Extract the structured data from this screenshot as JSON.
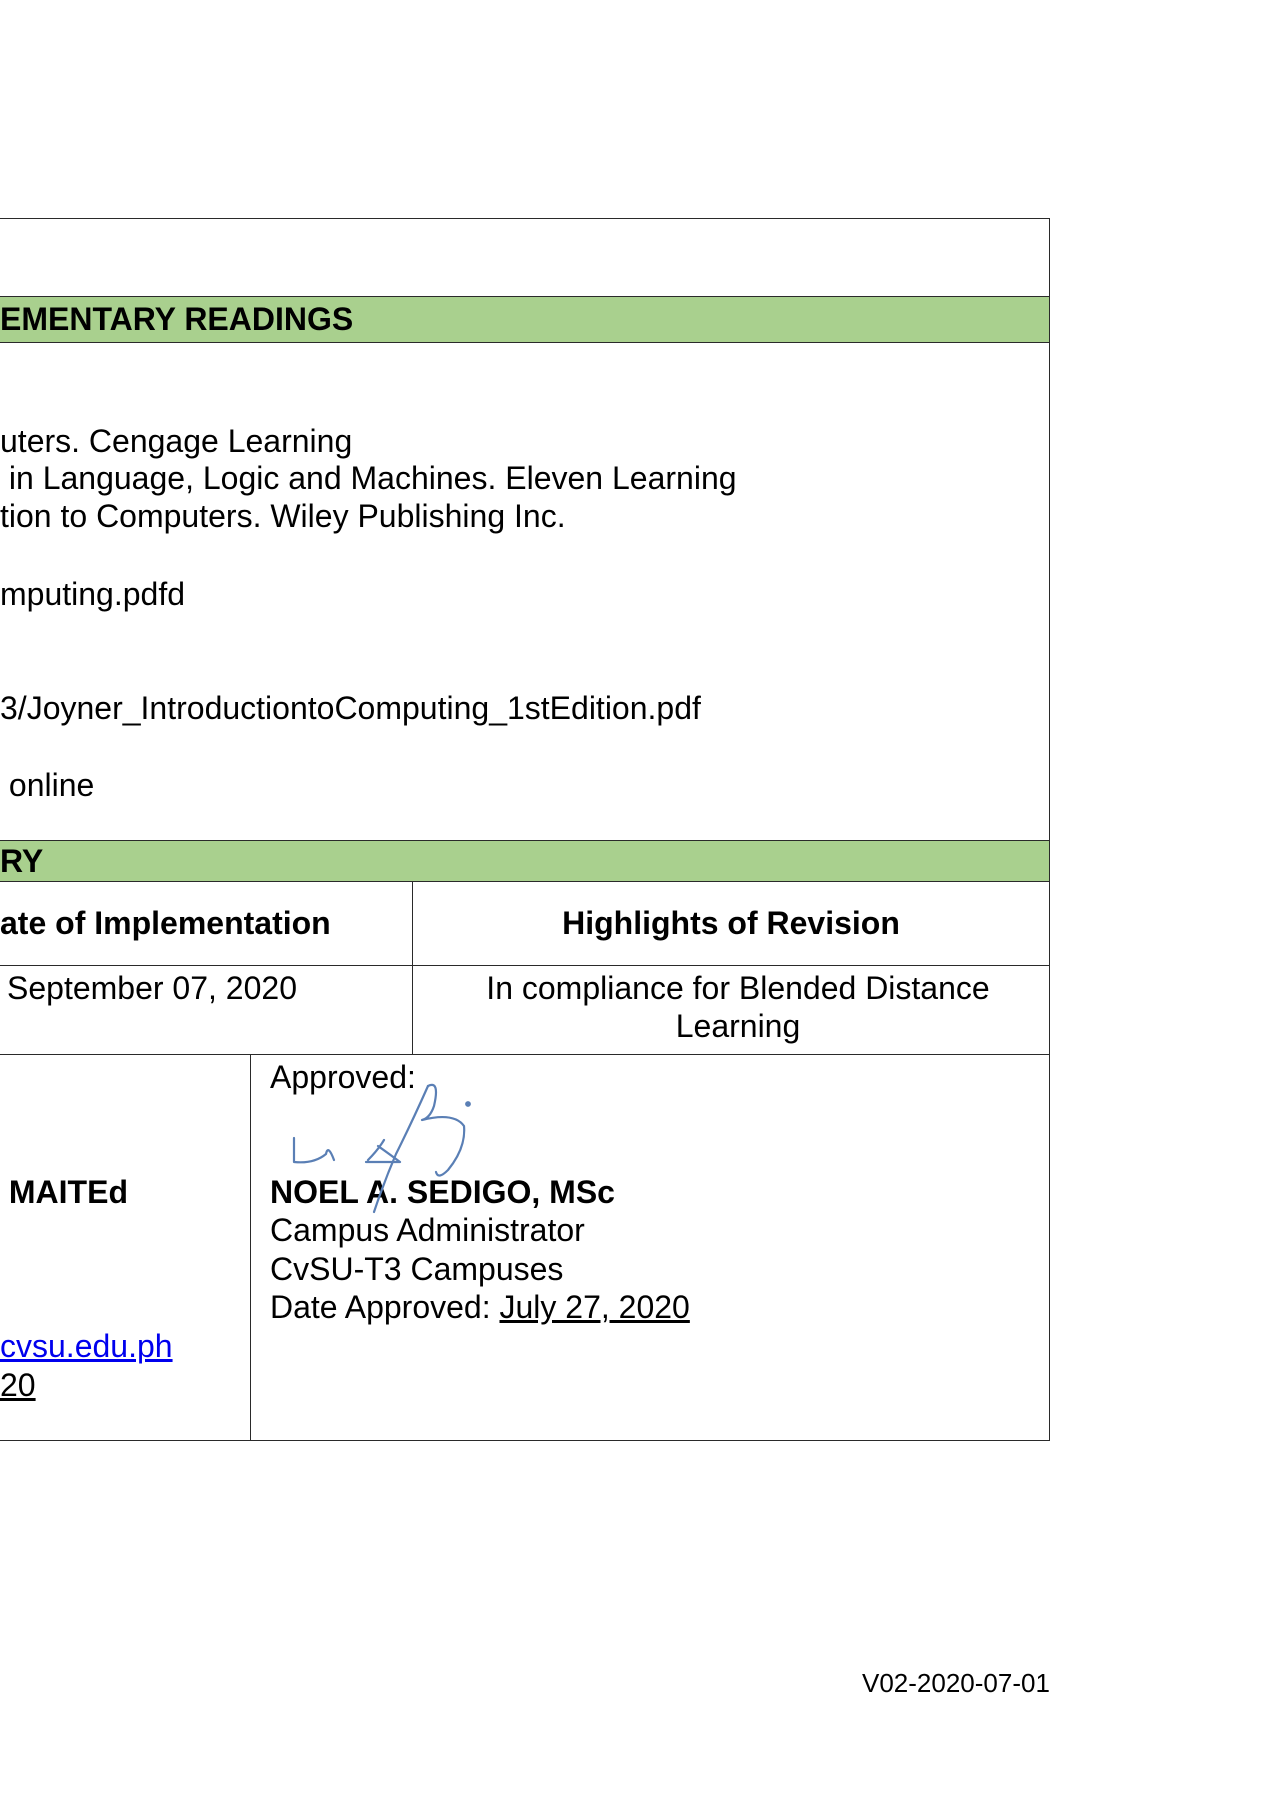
{
  "references": {
    "header": "EMENTARY READINGS",
    "lines": [
      "uters. Cengage Learning",
      " in Language, Logic and Machines. Eleven Learning",
      "tion to Computers. Wiley Publishing Inc.",
      "mputing.pdfd",
      "3/Joyner_IntroductiontoComputing_1stEdition.pdf",
      " online"
    ]
  },
  "revision_history": {
    "header": "RY",
    "col_date_header": "ate of Implementation",
    "col_highlights_header": "Highlights of Revision",
    "date_value": "September 07, 2020",
    "highlights_value": "In compliance for Blended Distance Learning"
  },
  "signatories": {
    "left_name": " MAITEd",
    "left_email": "cvsu.edu.ph",
    "left_date": "20",
    "approved_label": "Approved:",
    "approver_name": "NOEL A. SEDIGO, MSc",
    "approver_title": "Campus Administrator",
    "approver_office": "CvSU-T3 Campuses",
    "date_approved_label": "Date Approved: ",
    "date_approved_value": "July 27, 2020"
  },
  "footer": {
    "version": "V02-2020-07-01"
  },
  "colors": {
    "section_header_bg": "#a9d08e",
    "border": "#2a2a2a",
    "link": "#0000ee",
    "signature_ink": "#5a7fb5"
  }
}
